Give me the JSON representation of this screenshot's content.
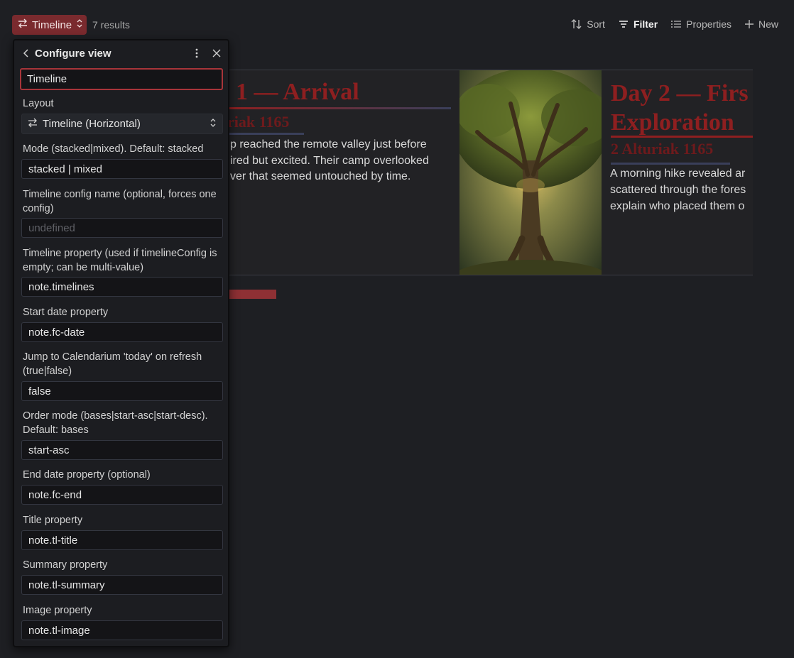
{
  "toolbar": {
    "view_name": "Timeline",
    "results": "7 results",
    "sort": "Sort",
    "filter": "Filter",
    "properties": "Properties",
    "new": "New"
  },
  "timeline": {
    "cards": [
      {
        "title": "1 — Arrival",
        "date": "riak 1165",
        "summary_lines": [
          "p reached the remote valley just before",
          "ired but excited. Their camp overlooked",
          "ver that seemed untouched by time."
        ]
      },
      {
        "title_lines": [
          "Day 2 — Firs",
          "Exploration"
        ],
        "date": "2 Alturiak 1165",
        "summary_lines": [
          "A morning hike revealed ar",
          "scattered through the fores",
          "explain who placed them o"
        ],
        "image": "ancient-tree-illustration"
      }
    ],
    "progress": 0.12
  },
  "panel": {
    "title": "Configure view",
    "name_value": "Timeline",
    "layout_label": "Layout",
    "layout_value": "Timeline (Horizontal)",
    "fields": [
      {
        "label": "Mode (stacked|mixed). Default: stacked",
        "value": "stacked | mixed"
      },
      {
        "label": "Timeline config name (optional, forces one config)",
        "placeholder": "undefined"
      },
      {
        "label": "Timeline property (used if timelineConfig is empty; can be multi-value)",
        "value": "note.timelines"
      },
      {
        "label": "Start date property",
        "value": "note.fc-date"
      },
      {
        "label": "Jump to Calendarium 'today' on refresh (true|false)",
        "value": "false"
      },
      {
        "label": "Order mode (bases|start-asc|start-desc). Default: bases",
        "value": "start-asc"
      },
      {
        "label": "End date property (optional)",
        "value": "note.fc-end"
      },
      {
        "label": "Title property",
        "value": "note.tl-title"
      },
      {
        "label": "Summary property",
        "value": "note.tl-summary"
      },
      {
        "label": "Image property",
        "value": "note.tl-image"
      }
    ]
  },
  "colors": {
    "accent": "#7a2a2e",
    "title_red": "#8e1f20",
    "focus_border": "#a8353a"
  },
  "icons": [
    "arrows-swap-icon",
    "chevron-updown-icon",
    "sort-icon",
    "filter-icon",
    "list-icon",
    "plus-icon",
    "chevron-left-icon",
    "more-vertical-icon",
    "close-icon"
  ]
}
